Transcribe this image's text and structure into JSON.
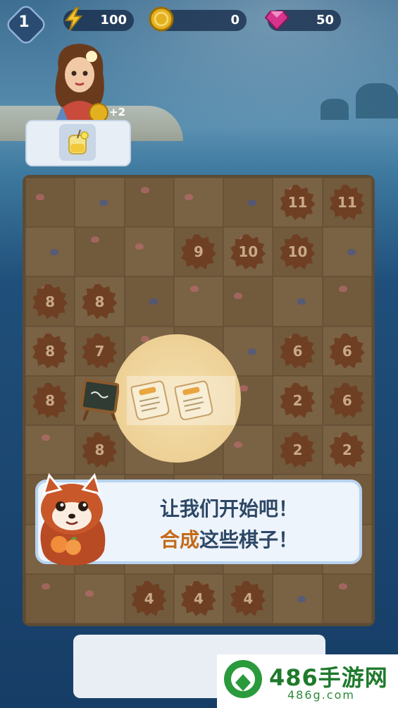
{
  "hud": {
    "level": "1",
    "energy": "100",
    "coins": "0",
    "gems": "50"
  },
  "order": {
    "reward": "+2",
    "item_icon": "lemonade-icon"
  },
  "board": {
    "rows": [
      [
        "",
        "",
        "",
        "",
        "",
        "11",
        "11"
      ],
      [
        "",
        "",
        "",
        "9",
        "10",
        "10",
        ""
      ],
      [
        "8",
        "8",
        "",
        "",
        "",
        "",
        ""
      ],
      [
        "8",
        "7",
        "",
        "",
        "",
        "6",
        "6"
      ],
      [
        "8",
        "",
        "",
        "",
        "",
        "2",
        "6"
      ],
      [
        "",
        "8",
        "",
        "",
        "",
        "2",
        "2"
      ],
      [
        "",
        "",
        "",
        "",
        "",
        "",
        ""
      ],
      [
        "",
        "",
        "",
        "",
        "",
        "",
        ""
      ],
      [
        "",
        "",
        "4",
        "4",
        "4",
        "",
        ""
      ]
    ]
  },
  "dialog": {
    "line1": "让我们开始吧！",
    "line2_highlight": "合成",
    "line2_rest": "这些棋子！"
  },
  "watermark": {
    "title": "486手游网",
    "url": "486g.com"
  },
  "colors": {
    "highlight": "#c46a18",
    "dialog_text": "#2d4866",
    "watermark_green": "#1f7a2c"
  }
}
